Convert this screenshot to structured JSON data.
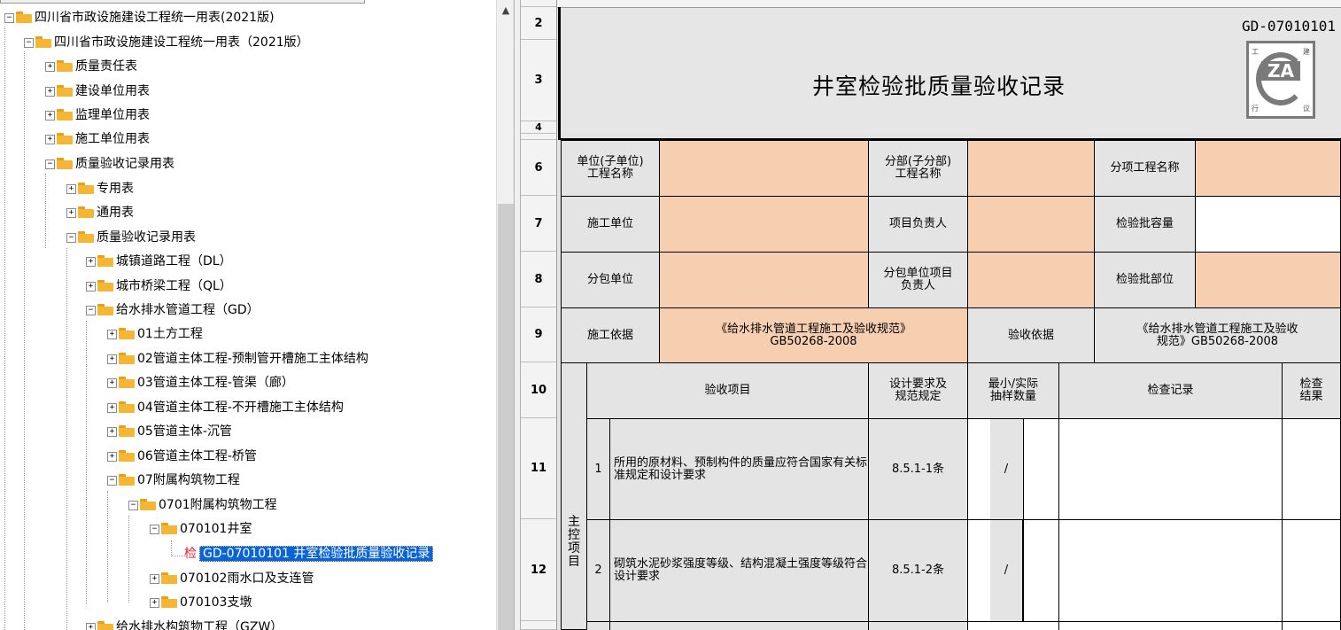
{
  "tree": {
    "nodes": [
      {
        "label": "四川省市政设施建设工程统一用表(2021版)"
      },
      {
        "label": "四川省市政设施建设工程统一用表（2021版）"
      },
      {
        "label": "质量责任表"
      },
      {
        "label": "建设单位用表"
      },
      {
        "label": "监理单位用表"
      },
      {
        "label": "施工单位用表"
      },
      {
        "label": "质量验收记录用表"
      },
      {
        "label": "专用表"
      },
      {
        "label": "通用表"
      },
      {
        "label": "质量验收记录用表"
      },
      {
        "label": "城镇道路工程（DL）"
      },
      {
        "label": "城市桥梁工程（QL）"
      },
      {
        "label": "给水排水管道工程（GD）"
      },
      {
        "label": "01土方工程"
      },
      {
        "label": "02管道主体工程-预制管开槽施工主体结构"
      },
      {
        "label": "03管道主体工程-管渠（廊）"
      },
      {
        "label": "04管道主体工程-不开槽施工主体结构"
      },
      {
        "label": "05管道主体-沉管"
      },
      {
        "label": "06管道主体工程-桥管"
      },
      {
        "label": "07附属构筑物工程"
      },
      {
        "label": "0701附属构筑物工程"
      },
      {
        "label": "070101井室"
      },
      {
        "label": "GD-07010101 井室检验批质量验收记录",
        "badge": "检"
      },
      {
        "label": "070102雨水口及支连管"
      },
      {
        "label": "070103支墩"
      },
      {
        "label": "给水排水构筑物工程（GZW）"
      }
    ]
  },
  "sheet": {
    "row_numbers": [
      "2",
      "3",
      "4",
      "6",
      "7",
      "8",
      "9",
      "10",
      "11",
      "12"
    ],
    "form_code": "GD-07010101",
    "title": "井室检验批质量验收记录",
    "logo": {
      "text": "ZA",
      "corners": [
        "工",
        "建",
        "行",
        "议"
      ]
    },
    "labels": {
      "unit": "单位(子单位)\n工程名称",
      "subdivision": "分部(子分部)\n工程名称",
      "subitem": "分项工程名称",
      "contractor": "施工单位",
      "project_lead": "项目负责人",
      "batch_capacity": "检验批容量",
      "subcontractor": "分包单位",
      "sub_lead": "分包单位项目\n负责人",
      "batch_location": "检验批部位",
      "basis": "施工依据",
      "basis_value": "《给水排水管道工程施工及验收规范》\nGB50268-2008",
      "acceptance_basis": "验收依据",
      "acceptance_value": "《给水排水管道工程施工及验收\n规范》GB50268-2008",
      "item_header": "验收项目",
      "design_req": "设计要求及\n规范规定",
      "sample": "最小/实际\n抽样数量",
      "record": "检查记录",
      "result": "检查\n结果",
      "main_control": "主\n控\n项\n目"
    },
    "items": [
      {
        "no": "1",
        "text": "所用的原材料、预制构件的质量应符合国家有关标准规定和设计要求",
        "clause": "8.5.1-1条",
        "slash": "/"
      },
      {
        "no": "2",
        "text": "砌筑水泥砂浆强度等级、结构混凝土强度等级符合设计要求",
        "clause": "8.5.1-2条",
        "slash": "/"
      }
    ]
  }
}
